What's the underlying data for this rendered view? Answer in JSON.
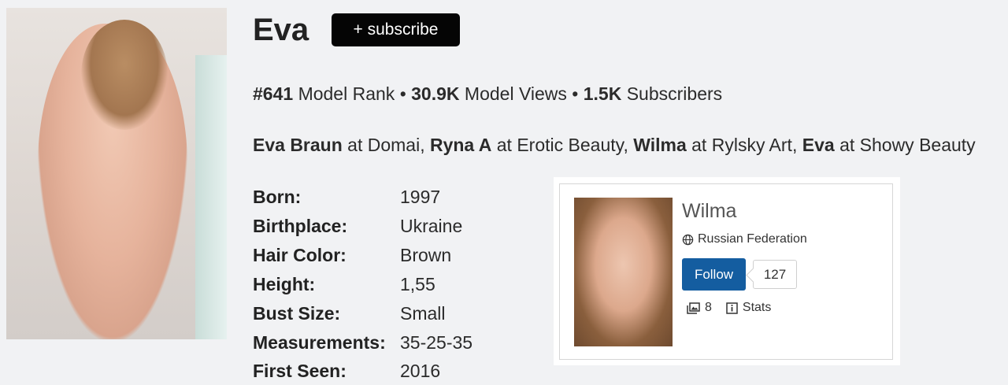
{
  "model": {
    "name": "Eva",
    "subscribe_label": "+ subscribe"
  },
  "stats": {
    "rank_value": "#641",
    "rank_label": "Model Rank",
    "views_value": "30.9K",
    "views_label": "Model Views",
    "subscribers_value": "1.5K",
    "subscribers_label": "Subscribers",
    "separator": "•"
  },
  "aliases": [
    {
      "name": "Eva Braun",
      "at": "at",
      "site": "Domai",
      "sep": ","
    },
    {
      "name": "Ryna A",
      "at": "at",
      "site": "Erotic Beauty",
      "sep": ","
    },
    {
      "name": "Wilma",
      "at": "at",
      "site": "Rylsky Art",
      "sep": ","
    },
    {
      "name": "Eva",
      "at": "at",
      "site": "Showy Beauty",
      "sep": ""
    }
  ],
  "details": [
    {
      "label": "Born:",
      "value": "1997"
    },
    {
      "label": "Birthplace:",
      "value": "Ukraine"
    },
    {
      "label": "Hair Color:",
      "value": "Brown"
    },
    {
      "label": "Height:",
      "value": "1,55"
    },
    {
      "label": "Bust Size:",
      "value": "Small"
    },
    {
      "label": "Measurements:",
      "value": "35-25-35"
    },
    {
      "label": "First Seen:",
      "value": "2016"
    }
  ],
  "card": {
    "name": "Wilma",
    "country": "Russian Federation",
    "follow_label": "Follow",
    "follow_count": "127",
    "galleries_count": "8",
    "stats_label": "Stats"
  },
  "icons": {
    "globe": "globe-icon",
    "gallery": "gallery-icon",
    "info": "info-icon"
  },
  "colors": {
    "subscribe_bg": "#050505",
    "follow_bg": "#145da0",
    "page_bg": "#f1f2f4"
  }
}
